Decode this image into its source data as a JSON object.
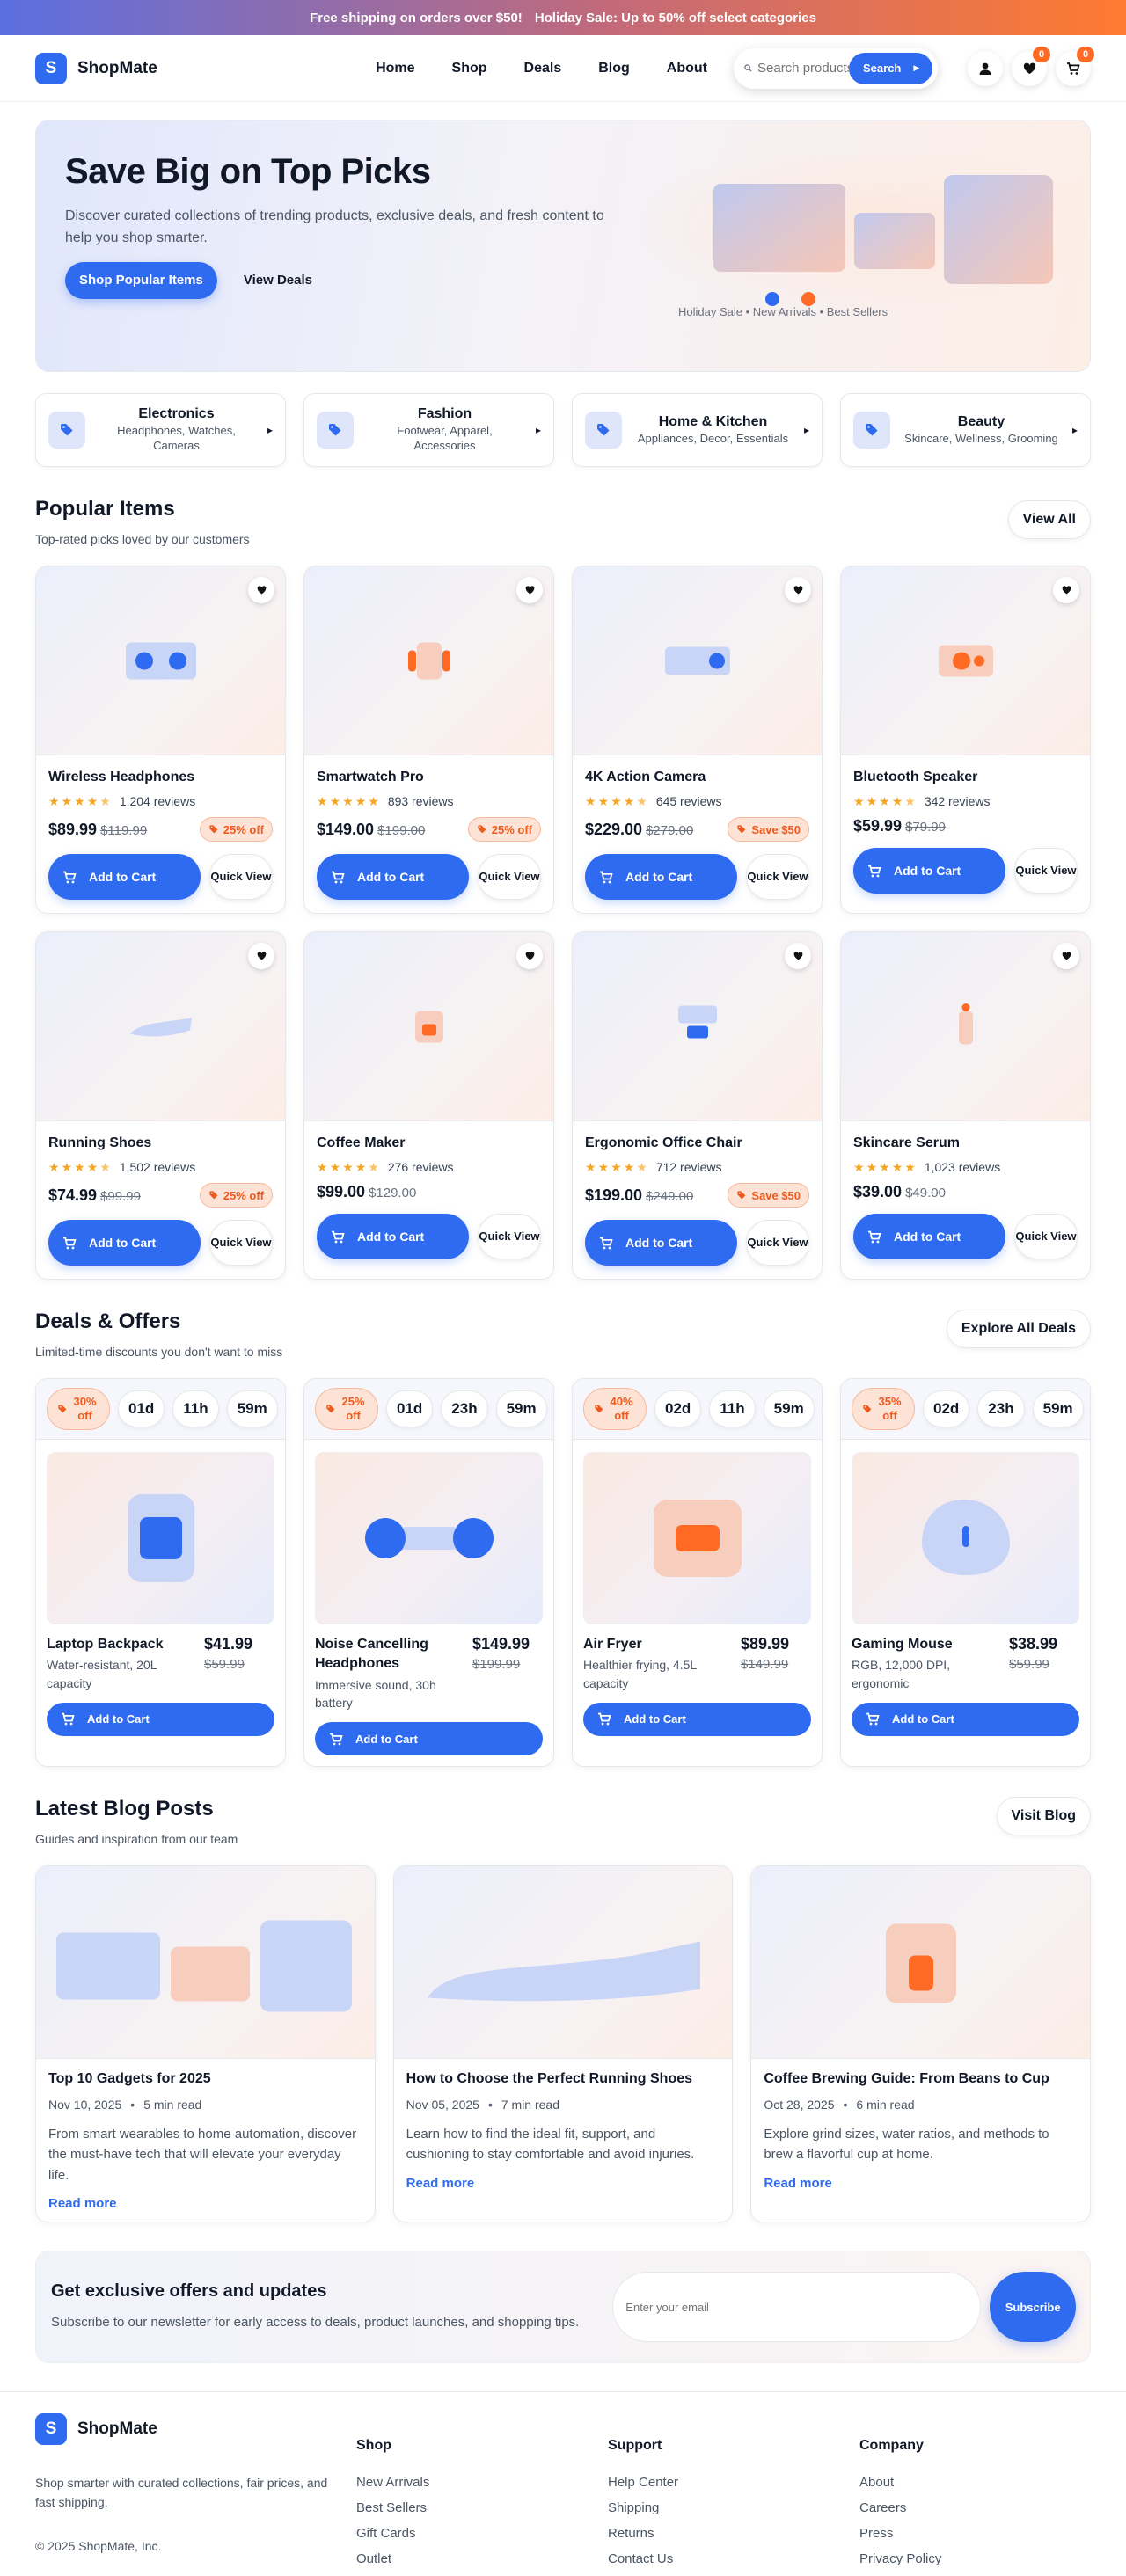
{
  "announcement": {
    "shipping": "Free shipping on orders over $50!",
    "sale": "Holiday Sale: Up to 50% off select categories"
  },
  "brand": {
    "logo_letter": "S",
    "name": "ShopMate"
  },
  "nav": [
    "Home",
    "Shop",
    "Deals",
    "Blog",
    "About"
  ],
  "search": {
    "placeholder": "Search products",
    "button": "Search"
  },
  "header_icons": {
    "account": "user-icon",
    "wishlist": "heart-icon",
    "cart": "cart-icon",
    "wishlist_count": "0",
    "cart_count": "0"
  },
  "hero": {
    "title": "Save Big on Top Picks",
    "subtitle": "Discover curated collections of trending products, exclusive deals, and fresh content to help you shop smarter.",
    "cta_primary": "Shop Popular Items",
    "cta_secondary": "View Deals",
    "caption": "Holiday Sale • New Arrivals • Best Sellers"
  },
  "categories": [
    {
      "title": "Electronics",
      "sub": "Headphones, Watches, Cameras"
    },
    {
      "title": "Fashion",
      "sub": "Footwear, Apparel, Accessories"
    },
    {
      "title": "Home & Kitchen",
      "sub": "Appliances, Decor, Essentials"
    },
    {
      "title": "Beauty",
      "sub": "Skincare, Wellness, Grooming"
    }
  ],
  "popular": {
    "title": "Popular Items",
    "subtitle": "Top-rated picks loved by our customers",
    "button": "View All",
    "add_label": "Add to Cart",
    "quick_label": "Quick View",
    "items": [
      {
        "name": "Wireless Headphones",
        "rating": 4.5,
        "reviews": "1,204 reviews",
        "price": "$89.99",
        "old": "$119.99",
        "badge": "25% off",
        "art": "headphones"
      },
      {
        "name": "Smartwatch Pro",
        "rating": 4.8,
        "reviews": "893 reviews",
        "price": "$149.00",
        "old": "$199.00",
        "badge": "25% off",
        "art": "watch"
      },
      {
        "name": "4K Action Camera",
        "rating": 4.5,
        "reviews": "645 reviews",
        "price": "$229.00",
        "old": "$279.00",
        "badge": "Save $50",
        "art": "camera"
      },
      {
        "name": "Bluetooth Speaker",
        "rating": 4.5,
        "reviews": "342 reviews",
        "price": "$59.99",
        "old": "$79.99",
        "badge": "",
        "art": "speaker"
      },
      {
        "name": "Running Shoes",
        "rating": 4.5,
        "reviews": "1,502 reviews",
        "price": "$74.99",
        "old": "$99.99",
        "badge": "25% off",
        "art": "shoe"
      },
      {
        "name": "Coffee Maker",
        "rating": 4.5,
        "reviews": "276 reviews",
        "price": "$99.00",
        "old": "$129.00",
        "badge": "",
        "art": "coffee"
      },
      {
        "name": "Ergonomic Office Chair",
        "rating": 4.5,
        "reviews": "712 reviews",
        "price": "$199.00",
        "old": "$249.00",
        "badge": "Save $50",
        "art": "chair"
      },
      {
        "name": "Skincare Serum",
        "rating": 4.8,
        "reviews": "1,023 reviews",
        "price": "$39.00",
        "old": "$49.00",
        "badge": "",
        "art": "serum"
      }
    ]
  },
  "deals": {
    "title": "Deals & Offers",
    "subtitle": "Limited-time discounts you don't want to miss",
    "button": "Explore All Deals",
    "add_label": "Add to Cart",
    "items": [
      {
        "badge": "30% off",
        "timer": [
          "01d",
          "11h",
          "59m"
        ],
        "name": "Laptop Backpack",
        "desc": "Water-resistant, 20L capacity",
        "price": "$41.99",
        "old": "$59.99",
        "art": "backpack"
      },
      {
        "badge": "25% off",
        "timer": [
          "01d",
          "23h",
          "59m"
        ],
        "name": "Noise Cancelling Headphones",
        "desc": "Immersive sound, 30h battery",
        "price": "$149.99",
        "old": "$199.99",
        "art": "headphones2"
      },
      {
        "badge": "40% off",
        "timer": [
          "02d",
          "11h",
          "59m"
        ],
        "name": "Air Fryer",
        "desc": "Healthier frying, 4.5L capacity",
        "price": "$89.99",
        "old": "$149.99",
        "art": "fryer"
      },
      {
        "badge": "35% off",
        "timer": [
          "02d",
          "23h",
          "59m"
        ],
        "name": "Gaming Mouse",
        "desc": "RGB, 12,000 DPI, ergonomic",
        "price": "$38.99",
        "old": "$59.99",
        "art": "mouse"
      }
    ]
  },
  "blog": {
    "title": "Latest Blog Posts",
    "subtitle": "Guides and inspiration from our team",
    "button": "Visit Blog",
    "read_more": "Read more",
    "posts": [
      {
        "title": "Top 10 Gadgets for 2025",
        "date": "Nov 10, 2025",
        "read": "5 min read",
        "excerpt": "From smart wearables to home automation, discover the must-have tech that will elevate your everyday life.",
        "art": "gadgets"
      },
      {
        "title": "How to Choose the Perfect Running Shoes",
        "date": "Nov 05, 2025",
        "read": "7 min read",
        "excerpt": "Learn how to find the ideal fit, support, and cushioning to stay comfortable and avoid injuries.",
        "art": "shoes"
      },
      {
        "title": "Coffee Brewing Guide: From Beans to Cup",
        "date": "Oct 28, 2025",
        "read": "6 min read",
        "excerpt": "Explore grind sizes, water ratios, and methods to brew a flavorful cup at home.",
        "art": "brew"
      }
    ]
  },
  "newsletter": {
    "title": "Get exclusive offers and updates",
    "text": "Subscribe to our newsletter for early access to deals, product launches, and shopping tips.",
    "placeholder": "Enter your email",
    "button": "Subscribe"
  },
  "footer": {
    "description": "Shop smarter with curated collections, fair prices, and fast shipping.",
    "copyright": "© 2025 ShopMate, Inc.",
    "columns": [
      {
        "title": "Shop",
        "links": [
          "New Arrivals",
          "Best Sellers",
          "Gift Cards",
          "Outlet"
        ]
      },
      {
        "title": "Support",
        "links": [
          "Help Center",
          "Shipping",
          "Returns",
          "Contact Us"
        ]
      },
      {
        "title": "Company",
        "links": [
          "About",
          "Careers",
          "Press",
          "Privacy Policy"
        ]
      }
    ]
  },
  "colors": {
    "primary": "#2f6bf0",
    "accent": "#ff6a24",
    "star": "#f5a623"
  }
}
